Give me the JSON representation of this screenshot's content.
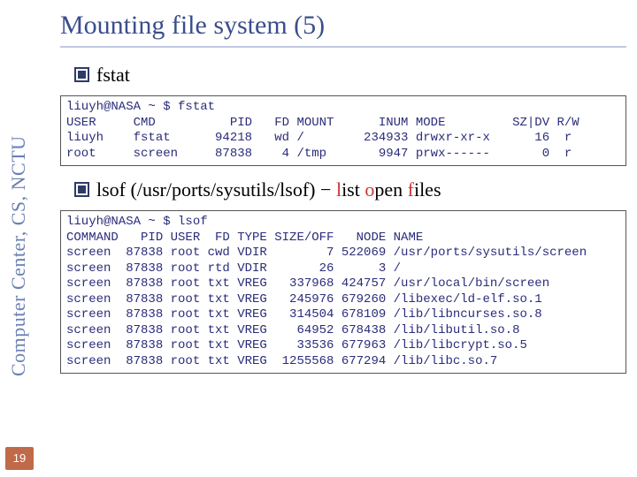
{
  "sidebar": {
    "label": "Computer Center, CS, NCTU"
  },
  "page_number": "19",
  "title": "Mounting file system (5)",
  "bullets": {
    "fstat": "fstat",
    "lsof_cmd": "lsof (/usr/ports/sysutils/lsof)",
    "lsof_sep": " − ",
    "lsof_l": "l",
    "lsof_ist": "ist ",
    "lsof_o": "o",
    "lsof_pen": "pen ",
    "lsof_f": "f",
    "lsof_iles": "iles"
  },
  "fstat_block": {
    "prompt": "liuyh@NASA ~ $ fstat",
    "header": "USER     CMD          PID   FD MOUNT      INUM MODE         SZ|DV R/W",
    "rows": [
      "liuyh    fstat      94218   wd /        234933 drwxr-xr-x      16  r",
      "root     screen     87838    4 /tmp       9947 prwx------       0  r"
    ]
  },
  "lsof_block": {
    "prompt": "liuyh@NASA ~ $ lsof",
    "header": "COMMAND   PID USER  FD TYPE SIZE/OFF   NODE NAME",
    "rows": [
      "screen  87838 root cwd VDIR        7 522069 /usr/ports/sysutils/screen",
      "screen  87838 root rtd VDIR       26      3 /",
      "screen  87838 root txt VREG   337968 424757 /usr/local/bin/screen",
      "screen  87838 root txt VREG   245976 679260 /libexec/ld-elf.so.1",
      "screen  87838 root txt VREG   314504 678109 /lib/libncurses.so.8",
      "screen  87838 root txt VREG    64952 678438 /lib/libutil.so.8",
      "screen  87838 root txt VREG    33536 677963 /lib/libcrypt.so.5",
      "screen  87838 root txt VREG  1255568 677294 /lib/libc.so.7"
    ]
  }
}
